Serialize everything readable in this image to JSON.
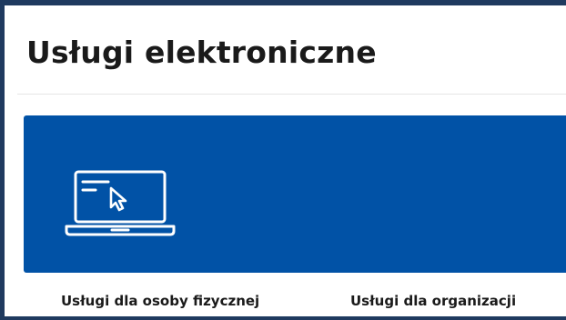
{
  "page": {
    "title": "Usługi elektroniczne"
  },
  "banner": {
    "icon": "laptop-cursor-icon",
    "color": "#0152a6"
  },
  "services": [
    {
      "label": "Usługi dla osoby fizycznej"
    },
    {
      "label": "Usługi dla organizacji"
    }
  ],
  "colors": {
    "frame": "#1f3a5f",
    "text": "#1a1a1a",
    "accent": "#0152a6"
  }
}
